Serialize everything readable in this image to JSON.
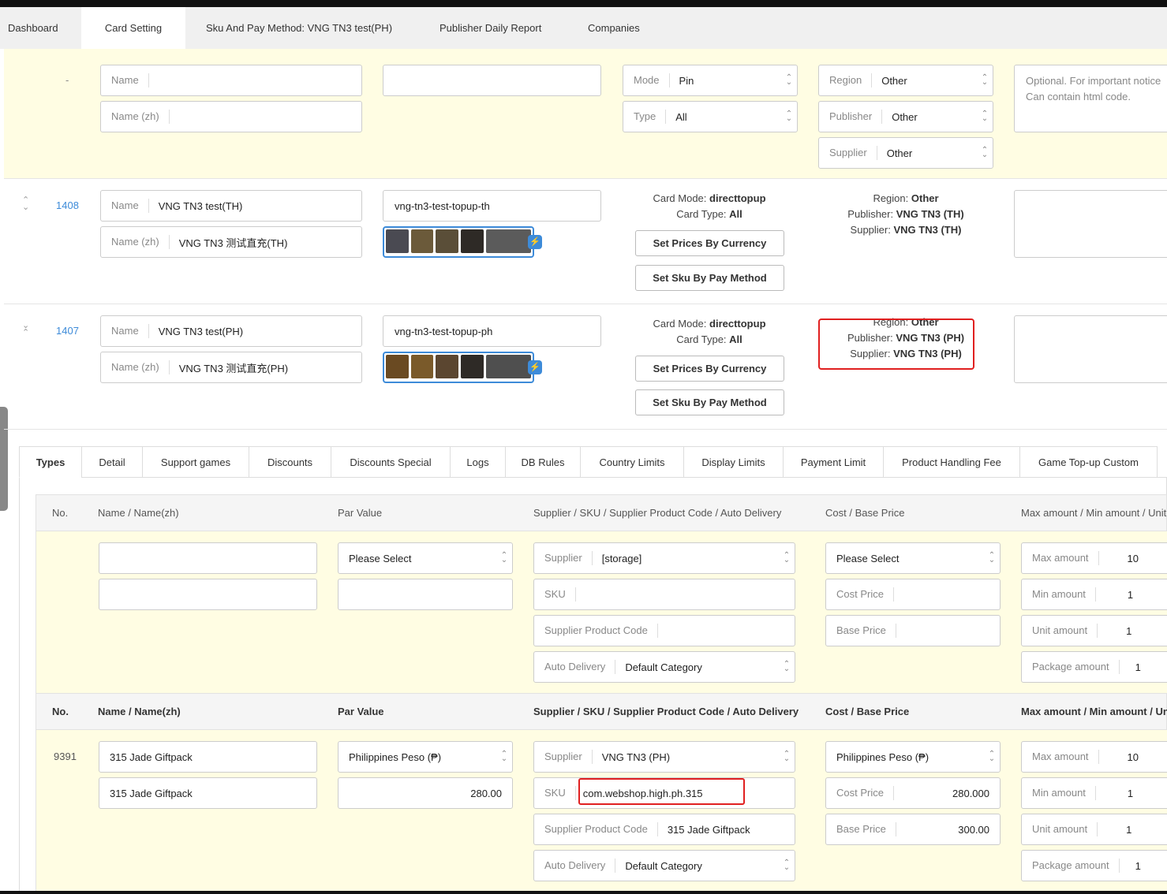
{
  "tabs": [
    "Dashboard",
    "Card Setting",
    "Sku And Pay Method: VNG TN3 test(PH)",
    "Publisher Daily Report",
    "Companies"
  ],
  "new_row": {
    "no": "-",
    "name_label": "Name",
    "name_zh_label": "Name (zh)",
    "mode_label": "Mode",
    "mode_value": "Pin",
    "type_label": "Type",
    "type_value": "All",
    "region_label": "Region",
    "region_value": "Other",
    "publisher_label": "Publisher",
    "publisher_value": "Other",
    "supplier_label": "Supplier",
    "supplier_value": "Other",
    "notice_placeholder": "Optional. For important notice Can contain html code."
  },
  "rows": [
    {
      "id": "1408",
      "name_label": "Name",
      "name": "VNG TN3 test(TH)",
      "name_zh_label": "Name (zh)",
      "name_zh": "VNG TN3 测试直充(TH)",
      "slug": "vng-tn3-test-topup-th",
      "card_mode_label": "Card Mode:",
      "card_mode": "directtopup",
      "card_type_label": "Card Type:",
      "card_type": "All",
      "btn_prices": "Set Prices By Currency",
      "btn_sku": "Set Sku By Pay Method",
      "region_label": "Region:",
      "region": "Other",
      "publisher_label": "Publisher:",
      "publisher": "VNG TN3 (TH)",
      "supplier_label": "Supplier:",
      "supplier": "VNG TN3 (TH)"
    },
    {
      "id": "1407",
      "name_label": "Name",
      "name": "VNG TN3 test(PH)",
      "name_zh_label": "Name (zh)",
      "name_zh": "VNG TN3 测试直充(PH)",
      "slug": "vng-tn3-test-topup-ph",
      "card_mode_label": "Card Mode:",
      "card_mode": "directtopup",
      "card_type_label": "Card Type:",
      "card_type": "All",
      "btn_prices": "Set Prices By Currency",
      "btn_sku": "Set Sku By Pay Method",
      "region_label": "Region:",
      "region": "Other",
      "publisher_label": "Publisher:",
      "publisher": "VNG TN3 (PH)",
      "supplier_label": "Supplier:",
      "supplier": "VNG TN3 (PH)"
    }
  ],
  "subtabs": [
    "Types",
    "Detail",
    "Support games",
    "Discounts",
    "Discounts Special",
    "Logs",
    "DB Rules",
    "Country Limits",
    "Display Limits",
    "Payment Limit",
    "Product Handling Fee",
    "Game Top-up Custom"
  ],
  "type_table": {
    "headers": [
      "No.",
      "Name / Name(zh)",
      "Par Value",
      "Supplier / SKU / Supplier Product Code / Auto Delivery",
      "Cost / Base Price",
      "Max amount / Min amount / Unit"
    ],
    "headers2": [
      "No.",
      "Name / Name(zh)",
      "Par Value",
      "Supplier / SKU / Supplier Product Code / Auto Delivery",
      "Cost / Base Price",
      "Max amount / Min amount / Unit"
    ],
    "new_type": {
      "par_value": "Please Select",
      "supplier_label": "Supplier",
      "supplier": "[storage]",
      "sku_label": "SKU",
      "spc_label": "Supplier Product Code",
      "auto_label": "Auto Delivery",
      "auto": "Default Category",
      "cost_currency": "Please Select",
      "cost_label": "Cost Price",
      "base_label": "Base Price",
      "max_label": "Max amount",
      "max": "10",
      "min_label": "Min amount",
      "min": "1",
      "unit_label": "Unit amount",
      "unit": "1",
      "pkg_label": "Package amount",
      "pkg": "1"
    },
    "item": {
      "no": "9391",
      "name": "315 Jade Giftpack",
      "name_zh": "315 Jade Giftpack",
      "par_currency": "Philippines Peso (₱)",
      "par_value": "280.00",
      "supplier_label": "Supplier",
      "supplier": "VNG TN3 (PH)",
      "sku_label": "SKU",
      "sku": "com.webshop.high.ph.315",
      "spc_label": "Supplier Product Code",
      "spc": "315 Jade Giftpack",
      "auto_label": "Auto Delivery",
      "auto": "Default Category",
      "cost_currency": "Philippines Peso (₱)",
      "cost_label": "Cost Price",
      "cost": "280.000",
      "base_label": "Base Price",
      "base": "300.00",
      "max_label": "Max amount",
      "max": "10",
      "min_label": "Min amount",
      "min": "1",
      "unit_label": "Unit amount",
      "unit": "1",
      "pkg_label": "Package amount",
      "pkg": "1"
    }
  },
  "colors": {
    "highlight_bg": "#fffde3",
    "link": "#3d8bd9",
    "annotation": "#e02020"
  },
  "thumb_colors_th": [
    "#4a4a52",
    "#6b5a3a",
    "#5a4e38",
    "#2e2a26",
    "#5b5b5b"
  ],
  "thumb_colors_ph": [
    "#6a4a22",
    "#7a5a2a",
    "#5b4630",
    "#2e2a26",
    "#4f4f4f"
  ]
}
